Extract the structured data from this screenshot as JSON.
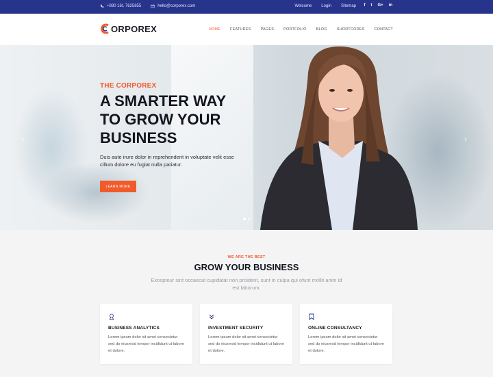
{
  "topbar": {
    "phone": "+880 161 7625855",
    "email": "hello@corporex.com",
    "links": [
      "Welcome",
      "Login",
      "Sitemap"
    ],
    "social": [
      "f",
      "t",
      "G+",
      "in"
    ]
  },
  "header": {
    "logo_text": "ORPOREX",
    "nav": [
      "HOME",
      "FEATURES",
      "PAGES",
      "PORTFOLIO",
      "BLOG",
      "SHORTCODES",
      "CONTACT"
    ]
  },
  "hero": {
    "subtitle": "THE CORPOREX",
    "title": "A SMARTER WAY TO GROW YOUR BUSINESS",
    "description": "Duis aute irure dolor in reprehenderit in voluptate velit esse cillum dolore eu fugiat nulla pariatur.",
    "button": "LEARN MORE",
    "prev_icon": "chevron-left-icon",
    "next_icon": "chevron-right-icon",
    "slide_count": 2,
    "active_slide": 1
  },
  "section": {
    "eyebrow": "WE ARE THE BEST",
    "title": "GROW YOUR BUSINESS",
    "description": "Excepteur sint occaecat cupidatat non proident, sunt in culpa qui ofunt mollit anim id est laborum."
  },
  "cards": [
    {
      "icon": "award-icon",
      "title": "BUSINESS ANALYTICS",
      "text": "Lorem ipsum dolor sit amet consectetur sed do eiusmod tempor incididunt ut labore et dolore."
    },
    {
      "icon": "chevrons-down-icon",
      "title": "INVESTMENT SECURITY",
      "text": "Lorem ipsum dolor sit amet consectetur sed do eiusmod tempor incididunt ut labore et dolore."
    },
    {
      "icon": "bookmark-icon",
      "title": "ONLINE CONSULTANCY",
      "text": "Lorem ipsum dolor sit amet consectetur sed do eiusmod tempor incididunt ut labore et dolore."
    }
  ],
  "colors": {
    "accent": "#f15a2b",
    "topbar": "#27348b"
  }
}
